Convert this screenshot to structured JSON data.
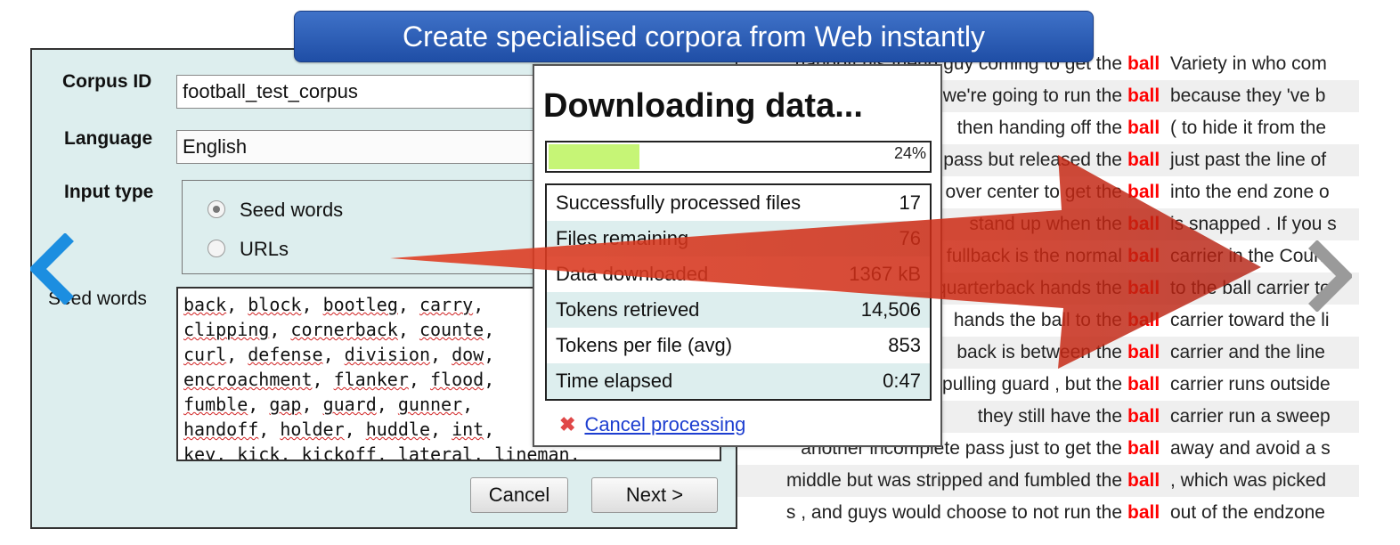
{
  "banner": {
    "title": "Create specialised corpora from Web instantly"
  },
  "form": {
    "corpus_id_label": "Corpus ID",
    "corpus_id_value": "football_test_corpus",
    "language_label": "Language",
    "language_value": "English",
    "input_type_label": "Input type",
    "input_options": [
      {
        "label": "Seed words",
        "selected": true
      },
      {
        "label": "URLs",
        "selected": false
      }
    ],
    "seed_words_label": "Seed words",
    "seed_lines": [
      [
        "back",
        "block",
        "bootleg",
        "carry"
      ],
      [
        "clipping",
        "cornerback",
        "counte"
      ],
      [
        "curl",
        "defense",
        "division",
        "dow"
      ],
      [
        "encroachment",
        "flanker",
        "flood"
      ],
      [
        "fumble",
        "gap",
        "guard",
        "gunner"
      ],
      [
        "handoff",
        "holder",
        "huddle",
        "int"
      ],
      [
        "key",
        "kick",
        "kickoff",
        "lateral",
        "lineman"
      ]
    ],
    "cancel_label": "Cancel",
    "next_label": "Next >"
  },
  "progress": {
    "title": "Downloading data...",
    "percent": 24,
    "percent_text": "24%",
    "stats": [
      {
        "label": "Successfully processed files",
        "value": "17"
      },
      {
        "label": "Files remaining",
        "value": "76"
      },
      {
        "label": "Data downloaded",
        "value": "1367 kB"
      },
      {
        "label": "Tokens retrieved",
        "value": "14,506"
      },
      {
        "label": "Tokens per file (avg)",
        "value": "853"
      },
      {
        "label": "Time elapsed",
        "value": "0:47"
      }
    ],
    "cancel_label": "Cancel processing"
  },
  "concordance": {
    "node": "ball",
    "lines": [
      {
        "left": "handoff his friend guy coming to get the",
        "right": "Variety in who com"
      },
      {
        "left": "we're going to run the",
        "right": "because they 've b"
      },
      {
        "left": "then handing off the",
        "right": "( to hide it from the"
      },
      {
        "left": "pass but released the",
        "right": "just past the line of"
      },
      {
        "left": "over center to get the",
        "right": "into the end zone o"
      },
      {
        "left": "stand up when the",
        "right": "is snapped . If you s"
      },
      {
        "left": "fullback is the normal",
        "right": "carrier in the  Coun"
      },
      {
        "left": "quarterback hands the",
        "right": "to the ball carrier to"
      },
      {
        "left": "hands the ball to the",
        "right": "carrier toward the li"
      },
      {
        "left": "back is between the",
        "right": "carrier and the line"
      },
      {
        "left": "pulling guard , but the",
        "right": "carrier runs outside"
      },
      {
        "left": "they still have the",
        "right": "carrier run a sweep"
      },
      {
        "left": "another incomplete pass just to get the",
        "right": "away and avoid a s"
      },
      {
        "left": "middle but was stripped and fumbled the",
        "right": ", which was picked"
      },
      {
        "left": "s , and guys would choose to not run the",
        "right": "out of the endzone"
      }
    ]
  },
  "colors": {
    "banner": "#2d5fb8",
    "panel": "#ddeeee",
    "progress_fill": "#c6f576",
    "node_word": "#ff0000",
    "link": "#1d3ed0",
    "arrow": "#d8321c"
  },
  "icons": {
    "prev": "chevron-left-icon",
    "next": "chevron-right-icon",
    "cancel": "close-icon",
    "overlay": "arrow-right-icon"
  }
}
